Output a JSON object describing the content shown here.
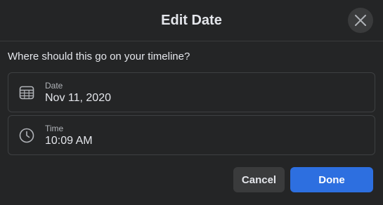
{
  "dialog": {
    "title": "Edit Date",
    "close_icon": "close-icon",
    "prompt": "Where should this go on your timeline?"
  },
  "date_field": {
    "label": "Date",
    "value": "Nov 11, 2020",
    "icon": "calendar-icon"
  },
  "time_field": {
    "label": "Time",
    "value": "10:09 AM",
    "icon": "clock-icon"
  },
  "actions": {
    "cancel_label": "Cancel",
    "done_label": "Done"
  },
  "colors": {
    "background": "#242526",
    "primary_button": "#2d6fe0",
    "secondary_button": "#3a3b3c",
    "text": "#e4e6eb",
    "muted_text": "#b0b3b8"
  }
}
